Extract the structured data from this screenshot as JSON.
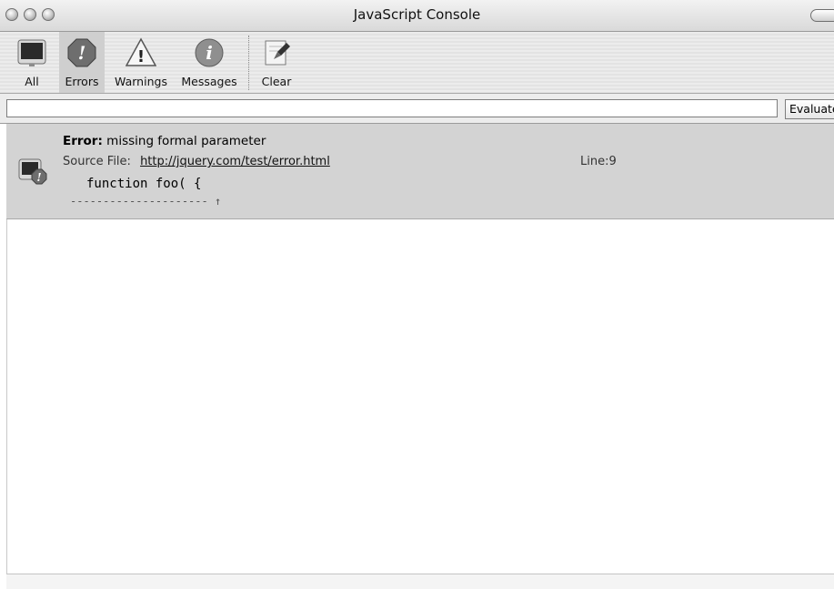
{
  "window": {
    "title": "JavaScript Console"
  },
  "toolbar": {
    "buttons": [
      {
        "label": "All",
        "icon": "all-icon"
      },
      {
        "label": "Errors",
        "icon": "errors-icon",
        "selected": true
      },
      {
        "label": "Warnings",
        "icon": "warning-icon"
      },
      {
        "label": "Messages",
        "icon": "info-icon"
      },
      {
        "label": "Clear",
        "icon": "clear-icon"
      }
    ]
  },
  "evaluate": {
    "input_value": "",
    "button_label": "Evaluate"
  },
  "entries": [
    {
      "type": "Error",
      "type_label": "Error:",
      "message": "missing formal parameter",
      "source_label": "Source File:",
      "source_url": "http://jquery.com/test/error.html",
      "line_label": "Line:9",
      "code": "function foo( {",
      "marker": "--------------------- ↑"
    }
  ]
}
